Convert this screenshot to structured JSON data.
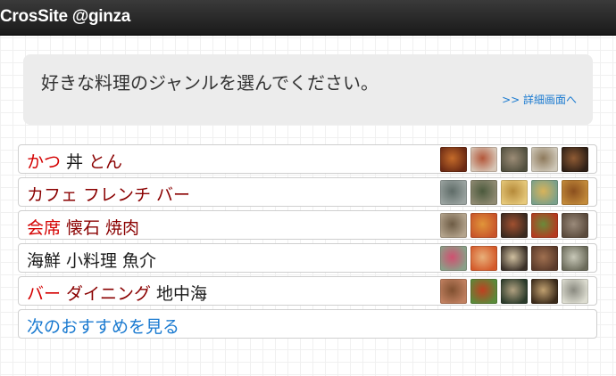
{
  "header": {
    "title": "CrosSite @ginza"
  },
  "prompt": {
    "text": "好きな料理のジャンルを選んでください。",
    "detail_link": ">> 詳細画面へ"
  },
  "categories": [
    {
      "labels": [
        {
          "text": "かつ",
          "color": "#d40000"
        },
        {
          "text": "丼",
          "color": "#1a1a1a"
        },
        {
          "text": "とん",
          "color": "#8a0000"
        }
      ],
      "thumb_colors": [
        [
          "#6b2a14",
          "#c46b2a"
        ],
        [
          "#d7c6b6",
          "#b3573a"
        ],
        [
          "#52503f",
          "#9c8c76"
        ],
        [
          "#cfc8b9",
          "#8e7a5c"
        ],
        [
          "#2f2016",
          "#8f5b34"
        ]
      ]
    },
    {
      "labels": [
        {
          "text": "カフェ",
          "color": "#8a0000"
        },
        {
          "text": "フレンチ",
          "color": "#8a0000"
        },
        {
          "text": "バー",
          "color": "#8a0000"
        }
      ],
      "thumb_colors": [
        [
          "#9aa3a0",
          "#5f6c68"
        ],
        [
          "#8f8a72",
          "#4c5a3d"
        ],
        [
          "#e6c87a",
          "#b58a3a"
        ],
        [
          "#7aa08a",
          "#d8b35a"
        ],
        [
          "#c28a3a",
          "#8b4f1e"
        ]
      ]
    },
    {
      "labels": [
        {
          "text": "会席",
          "color": "#d40000"
        },
        {
          "text": "懐石",
          "color": "#8a0000"
        },
        {
          "text": "焼肉",
          "color": "#8a0000"
        }
      ],
      "thumb_colors": [
        [
          "#b4a48d",
          "#6e5c45"
        ],
        [
          "#c8542a",
          "#e0953a"
        ],
        [
          "#3a2a20",
          "#a05030"
        ],
        [
          "#b53a20",
          "#6a8a3a"
        ],
        [
          "#5a4a3c",
          "#9a8a7a"
        ]
      ]
    },
    {
      "labels": [
        {
          "text": "海鮮",
          "color": "#1a1a1a"
        },
        {
          "text": "小料理",
          "color": "#1a1a1a"
        },
        {
          "text": "魚介",
          "color": "#1a1a1a"
        }
      ],
      "thumb_colors": [
        [
          "#8aa088",
          "#d05070"
        ],
        [
          "#d45a2a",
          "#e8b07a"
        ],
        [
          "#3a3028",
          "#d0c0a0"
        ],
        [
          "#5a3a2a",
          "#a07050"
        ],
        [
          "#6a6a5a",
          "#c8c8b8"
        ]
      ]
    },
    {
      "labels": [
        {
          "text": "バー",
          "color": "#d40000"
        },
        {
          "text": "ダイニング",
          "color": "#8a0000"
        },
        {
          "text": "地中海",
          "color": "#1a1a1a"
        }
      ],
      "thumb_colors": [
        [
          "#c08060",
          "#805030"
        ],
        [
          "#5a8a3a",
          "#c04020"
        ],
        [
          "#2a3a2a",
          "#b0a080"
        ],
        [
          "#3a2a1a",
          "#c0a070"
        ],
        [
          "#dcdcd0",
          "#8a8a80"
        ]
      ]
    }
  ],
  "next_link": "次のおすすめを見る"
}
